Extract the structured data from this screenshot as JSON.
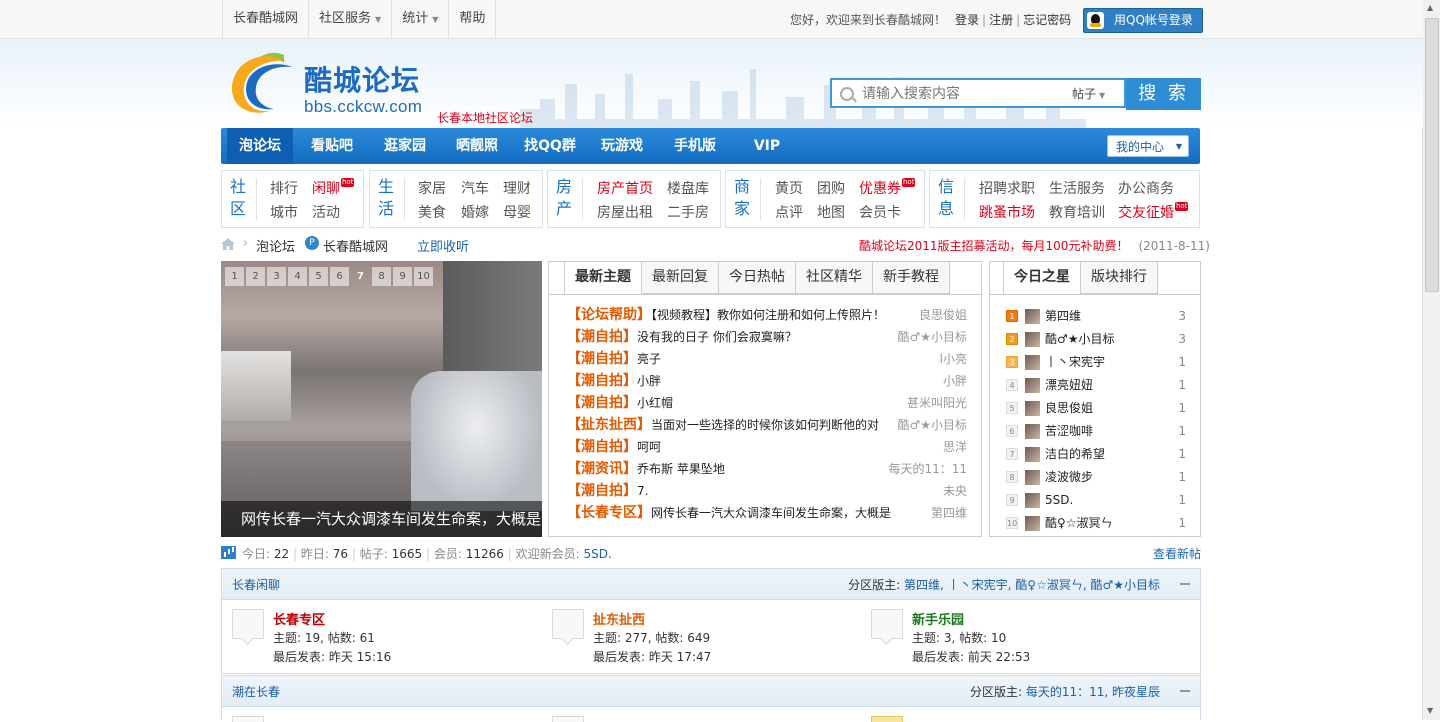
{
  "topbar": {
    "nav": [
      {
        "label": "长春酷城网",
        "dropdown": false
      },
      {
        "label": "社区服务",
        "dropdown": true
      },
      {
        "label": "统计",
        "dropdown": true
      },
      {
        "label": "帮助",
        "dropdown": false
      }
    ],
    "welcome": "您好，欢迎来到长春酷城网！",
    "login": "登录",
    "register": "注册",
    "forgot": "忘记密码",
    "qq_login": "用QQ帐号登录"
  },
  "header": {
    "site_name": "酷城论坛",
    "site_url": "bbs.cckcw.com",
    "tagline": "长春本地社区论坛",
    "search_placeholder": "请输入搜索内容",
    "search_scope": "帖子",
    "search_button": "搜 索"
  },
  "mainnav": {
    "items": [
      "泡论坛",
      "看贴吧",
      "逛家园",
      "晒靓照",
      "找QQ群",
      "玩游戏",
      "手机版",
      "VIP"
    ],
    "active": "泡论坛",
    "my_center": "我的中心"
  },
  "categories": [
    {
      "head": "社区",
      "links": [
        "排行",
        "闲聊",
        "城市",
        "活动"
      ],
      "hot": [
        "闲聊"
      ]
    },
    {
      "head": "生活",
      "links": [
        "家居",
        "汽车",
        "理财",
        "美食",
        "婚嫁",
        "母婴"
      ],
      "hot": []
    },
    {
      "head": "房产",
      "links": [
        "房产首页",
        "楼盘库",
        "房屋出租",
        "二手房"
      ],
      "hot": [
        "房产首页"
      ]
    },
    {
      "head": "商家",
      "links": [
        "黄页",
        "团购",
        "优惠券",
        "点评",
        "地图",
        "会员卡"
      ],
      "hot": [
        "优惠券"
      ]
    },
    {
      "head": "信息",
      "links": [
        "招聘求职",
        "生活服务",
        "办公商务",
        "跳蚤市场",
        "教育培训",
        "交友征婚"
      ],
      "hot": [
        "跳蚤市场",
        "交友征婚"
      ]
    }
  ],
  "badge_text": "hot",
  "breadcrumb": {
    "current": "泡论坛",
    "station": "长春酷城网",
    "listen": "立即收听"
  },
  "notice": {
    "text": "酷城论坛2011版主招募活动，每月100元补助费！",
    "date": "(2011-8-11)"
  },
  "slider": {
    "pages": [
      "1",
      "2",
      "3",
      "4",
      "5",
      "6",
      "7",
      "8",
      "9",
      "10"
    ],
    "current_page": "7",
    "caption": "网传长春一汽大众调漆车间发生命案，大概是"
  },
  "topics": {
    "tabs": [
      "最新主题",
      "最新回复",
      "今日热帖",
      "社区精华",
      "新手教程"
    ],
    "active_tab": "最新主题",
    "rows": [
      {
        "category": "【论坛帮助】",
        "title": "【视频教程】教你如何注册和如何上传照片！",
        "author": "良思俊姐"
      },
      {
        "category": "【潮自拍】",
        "title": "没有我的日子 你们会寂寞嘛？",
        "author": "酷♂★小目标"
      },
      {
        "category": "【潮自拍】",
        "title": "亮子",
        "author": "l小亮"
      },
      {
        "category": "【潮自拍】",
        "title": "小胖",
        "author": "小胖"
      },
      {
        "category": "【潮自拍】",
        "title": "小红帽",
        "author": "甚米叫阳光"
      },
      {
        "category": "【扯东扯西】",
        "title": "当面对一些选择的时候你该如何判断他的对",
        "author": "酷♂★小目标"
      },
      {
        "category": "【潮自拍】",
        "title": "呵呵",
        "author": "思洋"
      },
      {
        "category": "【潮资讯】",
        "title": "乔布斯 苹果坠地",
        "author": "每天的11：11"
      },
      {
        "category": "【潮自拍】",
        "title": "7.",
        "author": "未央"
      },
      {
        "category": "【长春专区】",
        "title": "网传长春一汽大众调漆车间发生命案，大概是",
        "author": "第四维"
      }
    ]
  },
  "stars": {
    "tabs": [
      "今日之星",
      "版块排行"
    ],
    "active_tab": "今日之星",
    "rows": [
      {
        "rank": "1",
        "name": "第四维",
        "count": "3"
      },
      {
        "rank": "2",
        "name": "酷♂★小目标",
        "count": "3"
      },
      {
        "rank": "3",
        "name": "丨丶宋宪宇",
        "count": "1"
      },
      {
        "rank": "4",
        "name": "漂亮妞妞",
        "count": "1"
      },
      {
        "rank": "5",
        "name": "良思俊姐",
        "count": "1"
      },
      {
        "rank": "6",
        "name": "苦涩咖啡",
        "count": "1"
      },
      {
        "rank": "7",
        "name": "洁白的希望",
        "count": "1"
      },
      {
        "rank": "8",
        "name": "凌波微步",
        "count": "1"
      },
      {
        "rank": "9",
        "name": "5SD.",
        "count": "1"
      },
      {
        "rank": "10",
        "name": "酷♀☆淑冥ㄣ",
        "count": "1"
      }
    ]
  },
  "stats": {
    "today_label": "今日:",
    "today": "22",
    "yesterday_label": "昨日:",
    "yesterday": "76",
    "posts_label": "帖子:",
    "posts": "1665",
    "members_label": "会员:",
    "members": "11266",
    "newest_label": "欢迎新会员:",
    "newest": "5SD.",
    "new_posts_link": "查看新帖"
  },
  "sections": [
    {
      "name": "长春闲聊",
      "mods_label": "分区版主:",
      "mods": "第四维, 丨丶宋宪宇, 酷♀☆淑冥ㄣ, 酷♂★小目标",
      "forums": [
        {
          "name": "长春专区",
          "color": "#c00000",
          "stats": "主题: 19, 帖数: 61",
          "last": "最后发表: 昨天 15:16"
        },
        {
          "name": "扯东扯西",
          "color": "#e45a00",
          "stats": "主题: 277, 帖数: 649",
          "last": "最后发表: 昨天 17:47"
        },
        {
          "name": "新手乐园",
          "color": "#1c7a1c",
          "stats": "主题: 3, 帖数: 10",
          "last": "最后发表: 前天 22:53"
        }
      ]
    },
    {
      "name": "潮在长春",
      "mods_label": "分区版主:",
      "mods": "每天的11：11, 昨夜星辰"
    }
  ],
  "colors": {
    "brand_blue": "#1b6cc0",
    "nav_blue": "#1a74c7",
    "hot_red": "#e0001b",
    "topic_orange": "#e45a00"
  }
}
